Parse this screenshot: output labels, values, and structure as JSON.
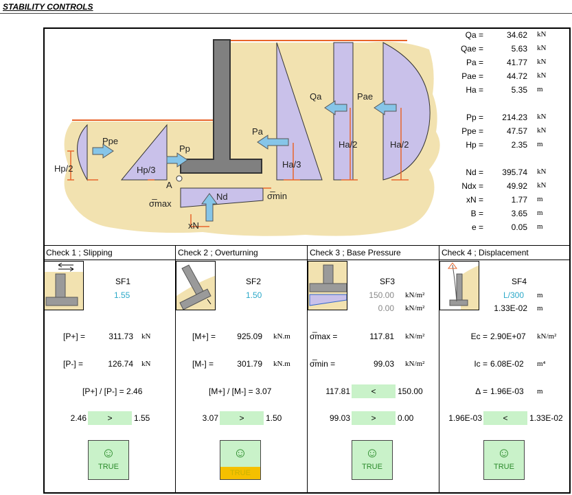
{
  "title": "STABILITY CONTROLS",
  "diagram_labels": {
    "hp2": "Hp/2",
    "ppe": "Ppe",
    "hp3": "Hp/3",
    "pp": "Pp",
    "pa": "Pa",
    "ha3": "Ha/3",
    "qa": "Qa",
    "ha2a": "Ha/2",
    "pae": "Pae",
    "ha2b": "Ha/2",
    "a": "A",
    "nd": "Nd",
    "smax": "σ̅max",
    "smin": "σ̅min",
    "xn": "xN"
  },
  "results": [
    {
      "label": "Qa =",
      "value": "34.62",
      "unit": "kN"
    },
    {
      "label": "Qae =",
      "value": "5.63",
      "unit": "kN"
    },
    {
      "label": "Pa =",
      "value": "41.77",
      "unit": "kN"
    },
    {
      "label": "Pae =",
      "value": "44.72",
      "unit": "kN"
    },
    {
      "label": "Ha =",
      "value": "5.35",
      "unit": "m"
    },
    {
      "label": "Pp =",
      "value": "214.23",
      "unit": "kN"
    },
    {
      "label": "Ppe =",
      "value": "47.57",
      "unit": "kN"
    },
    {
      "label": "Hp =",
      "value": "2.35",
      "unit": "m"
    },
    {
      "label": "Nd =",
      "value": "395.74",
      "unit": "kN"
    },
    {
      "label": "Ndx =",
      "value": "49.92",
      "unit": "kN"
    },
    {
      "label": "xN =",
      "value": "1.77",
      "unit": "m"
    },
    {
      "label": "B =",
      "value": "3.65",
      "unit": "m"
    },
    {
      "label": "e =",
      "value": "0.05",
      "unit": "m"
    }
  ],
  "checks": [
    {
      "header": "Check 1 ;  Slipping",
      "sf_label": "SF1",
      "sf_value": "1.55",
      "row1_label": "[P+] =",
      "row1_value": "311.73",
      "row1_unit": "kN",
      "row2_label": "[P-] =",
      "row2_value": "126.74",
      "row2_unit": "kN",
      "ratio": "[P+] / [P-] = 2.46",
      "cmp_left": "2.46",
      "cmp_op": ">",
      "cmp_right": "1.55",
      "status": "TRUE"
    },
    {
      "header": "Check 2 ;  Overturning",
      "sf_label": "SF2",
      "sf_value": "1.50",
      "row1_label": "[M+] =",
      "row1_value": "925.09",
      "row1_unit": "kN.m",
      "row2_label": "[M-] =",
      "row2_value": "301.79",
      "row2_unit": "kN.m",
      "ratio": "[M+] / [M-] = 3.07",
      "cmp_left": "3.07",
      "cmp_op": ">",
      "cmp_right": "1.50",
      "status": "TRUE"
    },
    {
      "header": "Check 3 ;  Base Pressure",
      "sf_label": "SF3",
      "sf_value1": "150.00",
      "sf_unit1": "kN/m²",
      "sf_value2": "0.00",
      "sf_unit2": "kN/m²",
      "row1_label": "σ̅max =",
      "row1_value": "117.81",
      "row1_unit": "kN/m²",
      "row2_label": "σ̅min =",
      "row2_value": "99.03",
      "row2_unit": "kN/m²",
      "cmp1_left": "117.81",
      "cmp1_op": "<",
      "cmp1_right": "150.00",
      "cmp_left": "99.03",
      "cmp_op": ">",
      "cmp_right": "0.00",
      "status": "TRUE"
    },
    {
      "header": "Check 4 ;  Displacement",
      "sf_label": "SF4",
      "sf_value": "L/300",
      "sf_unit": "m",
      "sf_value2": "1.33E-02",
      "sf_unit2": "m",
      "row1_label": "Ec =",
      "row1_value": "2.90E+07",
      "row1_unit": "kN/m²",
      "row2_label": "Ic =",
      "row2_value": "6.08E-02",
      "row2_unit": "m⁴",
      "delta_label": "Δ =",
      "delta_value": "1.96E-03",
      "delta_unit": "m",
      "cmp_left": "1.96E-03",
      "cmp_op": "<",
      "cmp_right": "1.33E-02",
      "status": "TRUE"
    }
  ],
  "status_icon": "☺",
  "colors": {
    "soil": "#f2e2b0",
    "load": "#c9c1ea",
    "arrow": "#86c5e8",
    "wall": "#808080",
    "ok": "#c9f2c9",
    "warn": "#f5c000",
    "line": "#e8642a"
  }
}
